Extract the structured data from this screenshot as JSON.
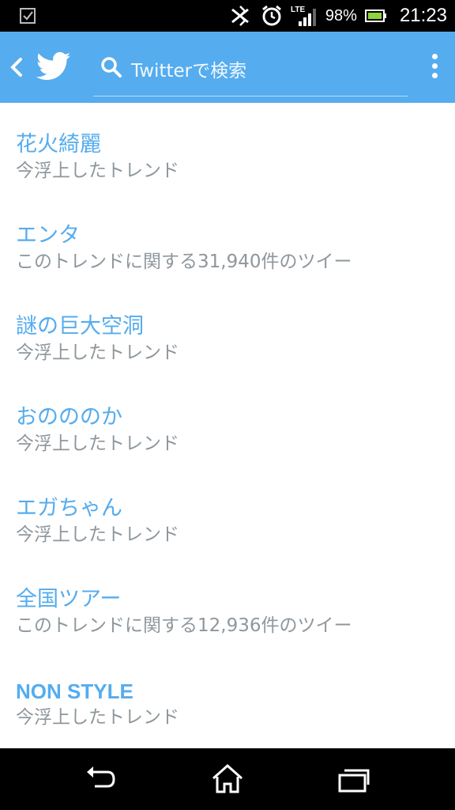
{
  "status_bar": {
    "battery_percent": "98%",
    "time": "21:23",
    "network": "LTE",
    "icons": [
      "checkbox-notification-icon",
      "bluetooth-icon",
      "alarm-icon",
      "lte-signal-icon",
      "battery-icon"
    ]
  },
  "app_bar": {
    "search_placeholder": "Twitterで検索",
    "brand_color": "#55acee"
  },
  "trends": [
    {
      "name": "花火綺麗",
      "subtitle": "今浮上したトレンド"
    },
    {
      "name": "エンタ",
      "subtitle": "このトレンドに関する31,940件のツイー"
    },
    {
      "name": "謎の巨大空洞",
      "subtitle": "今浮上したトレンド"
    },
    {
      "name": "おのののか",
      "subtitle": "今浮上したトレンド"
    },
    {
      "name": "エガちゃん",
      "subtitle": "今浮上したトレンド"
    },
    {
      "name": "全国ツアー",
      "subtitle": "このトレンドに関する12,936件のツイー"
    },
    {
      "name": "NON STYLE",
      "subtitle": "今浮上したトレンド"
    }
  ],
  "nav_bar": {
    "buttons": [
      "back-icon",
      "home-icon",
      "recents-icon"
    ]
  }
}
